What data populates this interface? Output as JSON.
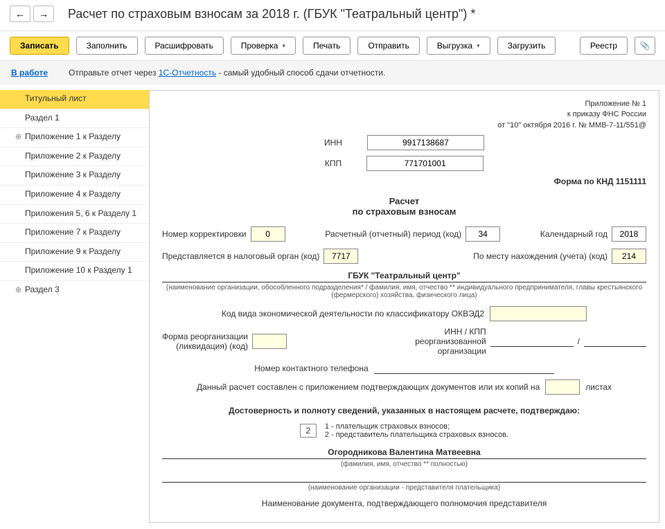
{
  "header": {
    "title": "Расчет по страховым взносам за 2018 г. (ГБУК \"Театральный центр\") *"
  },
  "toolbar": {
    "save": "Записать",
    "fill": "Заполнить",
    "decrypt": "Расшифровать",
    "check": "Проверка",
    "print": "Печать",
    "send": "Отправить",
    "export": "Выгрузка",
    "load": "Загрузить",
    "registry": "Реестр"
  },
  "info": {
    "status": "В работе",
    "hint_pre": "Отправьте отчет через ",
    "hint_link": "1С-Отчетность",
    "hint_post": " - самый удобный способ сдачи отчетности."
  },
  "sidebar": {
    "items": [
      {
        "label": "Титульный лист",
        "active": true
      },
      {
        "label": "Раздел 1"
      },
      {
        "label": "Приложение 1 к Разделу",
        "expandable": true
      },
      {
        "label": "Приложение 2 к Разделу"
      },
      {
        "label": "Приложение 3 к Разделу"
      },
      {
        "label": "Приложение 4 к Разделу"
      },
      {
        "label": "Приложения 5, 6 к Разделу 1"
      },
      {
        "label": "Приложение 7 к Разделу"
      },
      {
        "label": "Приложение 9 к Разделу"
      },
      {
        "label": "Приложение 10 к Разделу 1"
      },
      {
        "label": "Раздел 3",
        "expandable": true
      }
    ]
  },
  "form": {
    "annex1": "Приложение № 1",
    "annex2": "к приказу ФНС России",
    "annex3": "от \"10\" октября 2016 г. № ММВ-7-11/551@",
    "inn_label": "ИНН",
    "inn": "9917138687",
    "kpp_label": "КПП",
    "kpp": "771701001",
    "knd": "Форма по КНД 1151111",
    "title1": "Расчет",
    "title2": "по страховым взносам",
    "corr_label": "Номер корректировки",
    "corr": "0",
    "period_label": "Расчетный (отчетный) период (код)",
    "period": "34",
    "year_label": "Календарный год",
    "year": "2018",
    "tax_auth_label": "Представляется в налоговый орган (код)",
    "tax_auth": "7717",
    "loc_label": "По месту нахождения (учета) (код)",
    "loc": "214",
    "org": "ГБУК \"Театральный центр\"",
    "org_hint": "(наименование организации, обособленного подразделения* / фамилия, имя, отчество ** индивидуального предпринимателя, главы крестьянского (фермерского) хозяйства, физического лица)",
    "okved_label": "Код вида экономической деятельности по классификатору ОКВЭД2",
    "reorg_label": "Форма реорганизации (ликвидация) (код)",
    "reorg_inn_label": "ИНН / КПП реорганизованной организации",
    "phone_label": "Номер контактного телефона",
    "docs_label_pre": "Данный расчет составлен с приложением подтверждающих документов или их копий на",
    "docs_label_post": "листах",
    "confirm_title": "Достоверность и полноту сведений, указанных в настоящем расчете, подтверждаю:",
    "confirm_code": "2",
    "confirm_opt1": "1 - плательщик страховых взносов;",
    "confirm_opt2": "2 - представитель плательщика страховых взносов.",
    "fio": "Огородникова Валентина Матвеевна",
    "fio_hint": "(фамилия, имя, отчество ** полностью)",
    "rep_hint": "(наименование организации - представителя плательщика)",
    "doc_label": "Наименование документа, подтверждающего полномочия представителя"
  }
}
